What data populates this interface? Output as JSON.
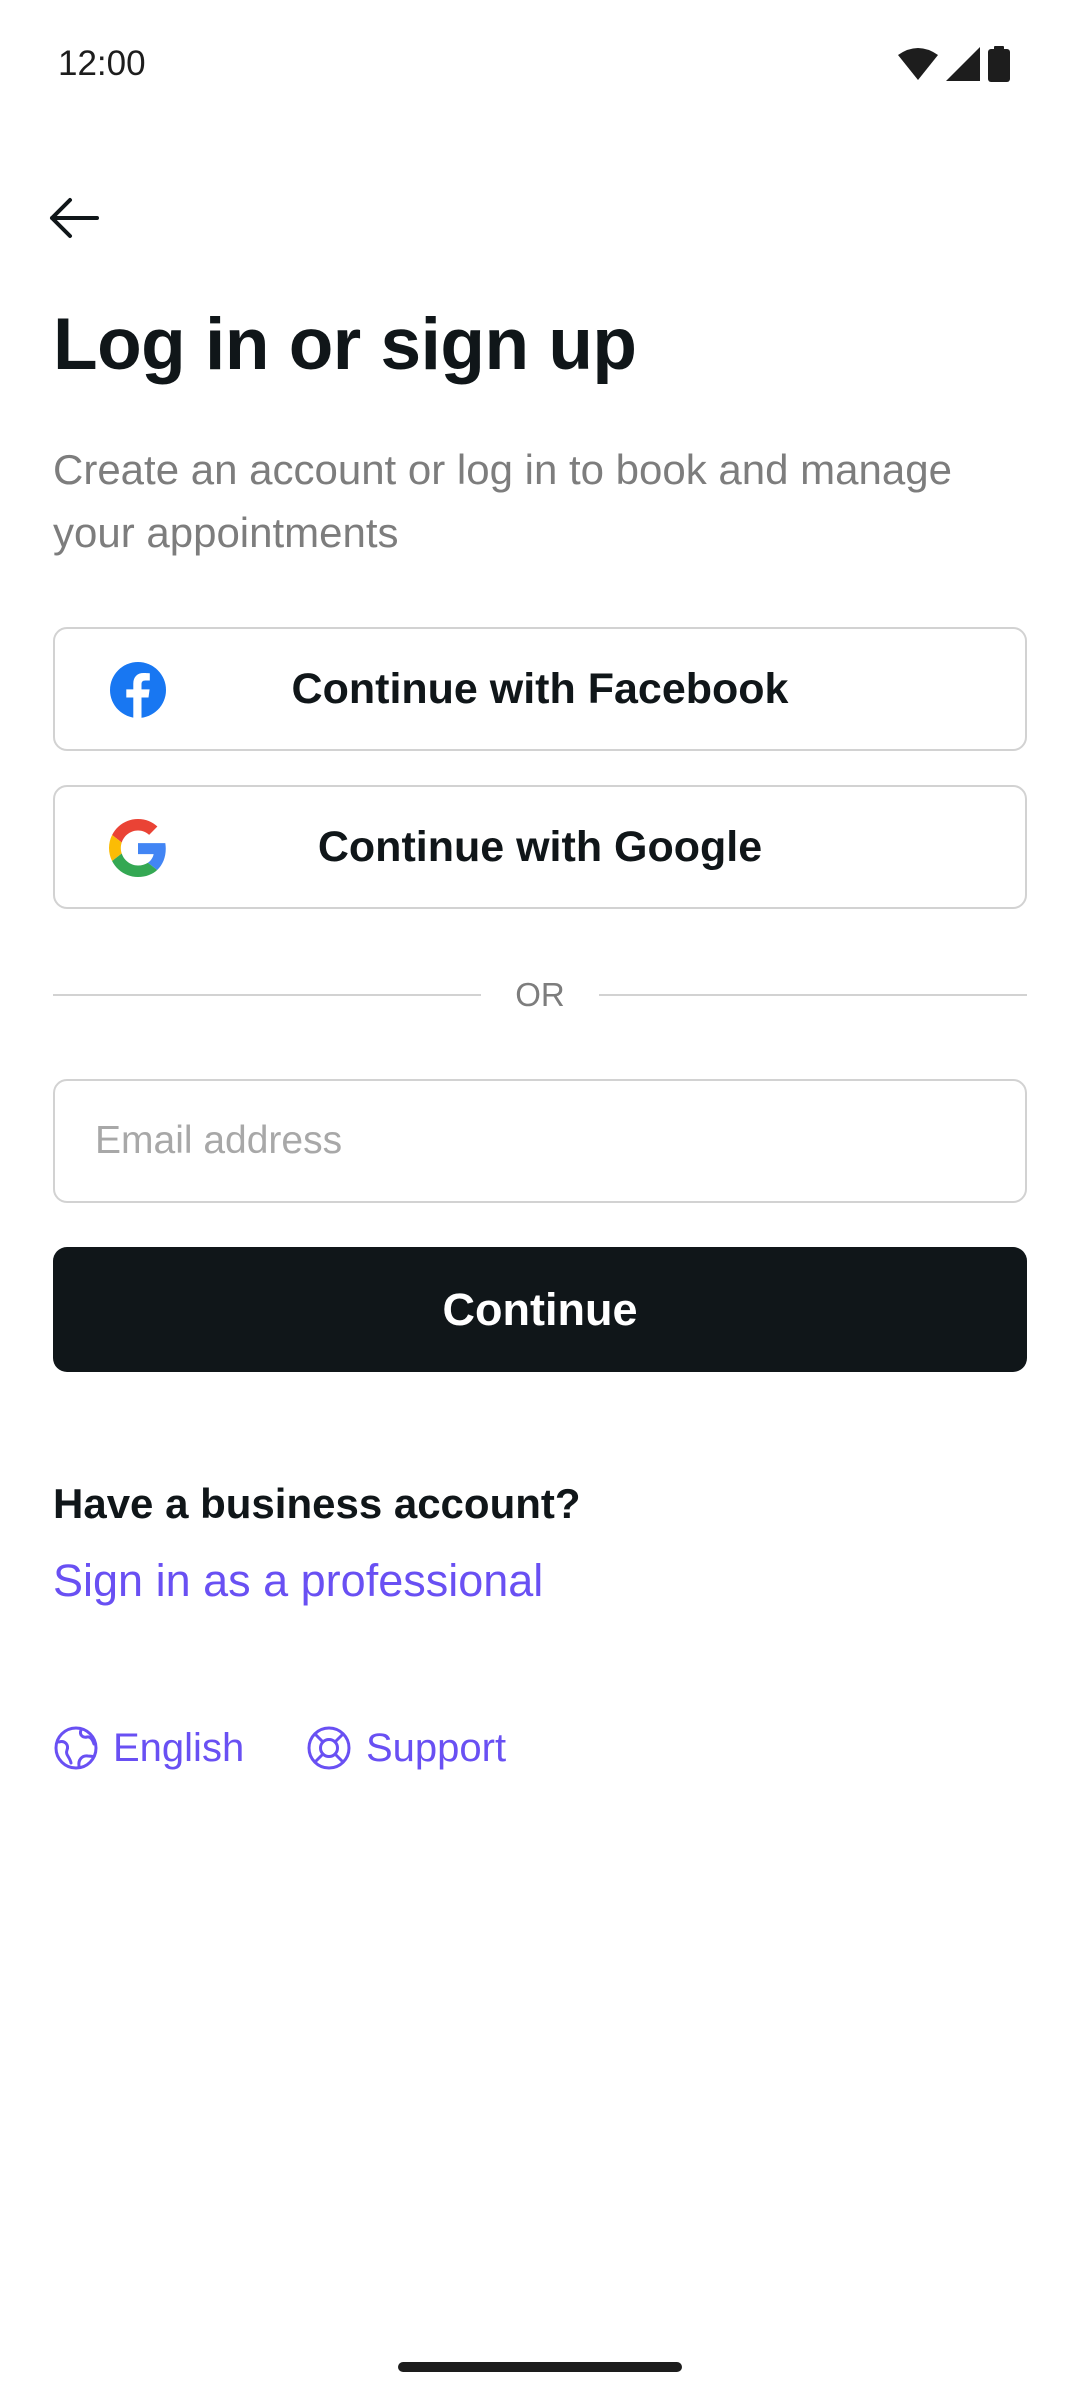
{
  "status_bar": {
    "time": "12:00",
    "icons": [
      "wifi-icon",
      "signal-icon",
      "battery-icon"
    ]
  },
  "header": {
    "back_icon": "arrow-left-icon",
    "title": "Log in or sign up",
    "subtitle": "Create an account or log in to book and manage your appointments"
  },
  "social": {
    "facebook_label": "Continue with Facebook",
    "google_label": "Continue with Google"
  },
  "divider": {
    "text": "OR"
  },
  "email": {
    "placeholder": "Email address",
    "value": ""
  },
  "continue_label": "Continue",
  "business": {
    "question": "Have a business account?",
    "link": "Sign in as a professional"
  },
  "footer": {
    "language": "English",
    "support": "Support"
  },
  "colors": {
    "primary_text": "#101619",
    "secondary_text": "#7d7d7d",
    "accent": "#6950f3",
    "border": "#d2d2d2",
    "facebook_blue": "#1877f2"
  }
}
